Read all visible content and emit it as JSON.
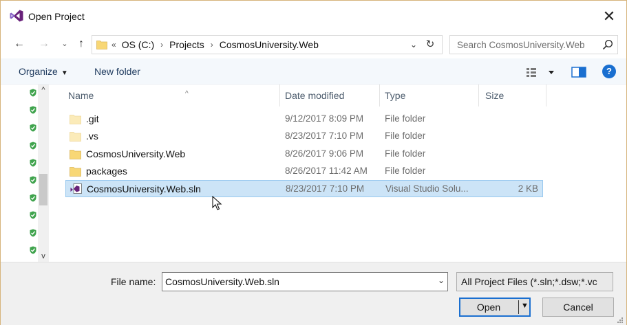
{
  "window": {
    "title": "Open Project",
    "close_glyph": "✕"
  },
  "nav": {
    "back_glyph": "←",
    "forward_glyph": "→",
    "recent_glyph": "⌄",
    "up_glyph": "↑",
    "overflow_glyph": "«",
    "separator_glyph": "›",
    "breadcrumbs": [
      "OS (C:)",
      "Projects",
      "CosmosUniversity.Web"
    ],
    "dropdown_glyph": "⌄",
    "refresh_glyph": "↻"
  },
  "search": {
    "placeholder": "Search CosmosUniversity.Web"
  },
  "toolbar": {
    "organize_label": "Organize",
    "organize_caret": "▼",
    "new_folder_label": "New folder",
    "help_label": "?"
  },
  "columns": {
    "name": "Name",
    "date_modified": "Date modified",
    "type": "Type",
    "size": "Size",
    "sort_glyph": "^"
  },
  "files": [
    {
      "name": ".git",
      "date": "9/12/2017 8:09 PM",
      "type": "File folder",
      "size": "",
      "icon": "folder-icon-faded",
      "selected": false
    },
    {
      "name": ".vs",
      "date": "8/23/2017 7:10 PM",
      "type": "File folder",
      "size": "",
      "icon": "folder-icon-faded",
      "selected": false
    },
    {
      "name": "CosmosUniversity.Web",
      "date": "8/26/2017 9:06 PM",
      "type": "File folder",
      "size": "",
      "icon": "folder-icon",
      "selected": false
    },
    {
      "name": "packages",
      "date": "8/26/2017 11:42 AM",
      "type": "File folder",
      "size": "",
      "icon": "folder-icon",
      "selected": false
    },
    {
      "name": "CosmosUniversity.Web.sln",
      "date": "8/23/2017 7:10 PM",
      "type": "Visual Studio Solu...",
      "size": "2 KB",
      "icon": "vs-solution-icon",
      "selected": true
    }
  ],
  "navpane": {
    "scroll_up_glyph": "^",
    "scroll_down_glyph": "v"
  },
  "footer": {
    "file_name_label": "File name:",
    "file_name_value": "CosmosUniversity.Web.sln",
    "file_name_drop_glyph": "⌄",
    "filter_value": "All Project Files (*.sln;*.dsw;*.vc",
    "open_label": "Open",
    "open_dropdown_glyph": "▼",
    "cancel_label": "Cancel"
  },
  "colors": {
    "accent": "#1a6fd0",
    "selection_bg": "#cce4f7",
    "selection_border": "#99c9ef",
    "vs_purple": "#68217a",
    "folder": "#f8d775"
  }
}
